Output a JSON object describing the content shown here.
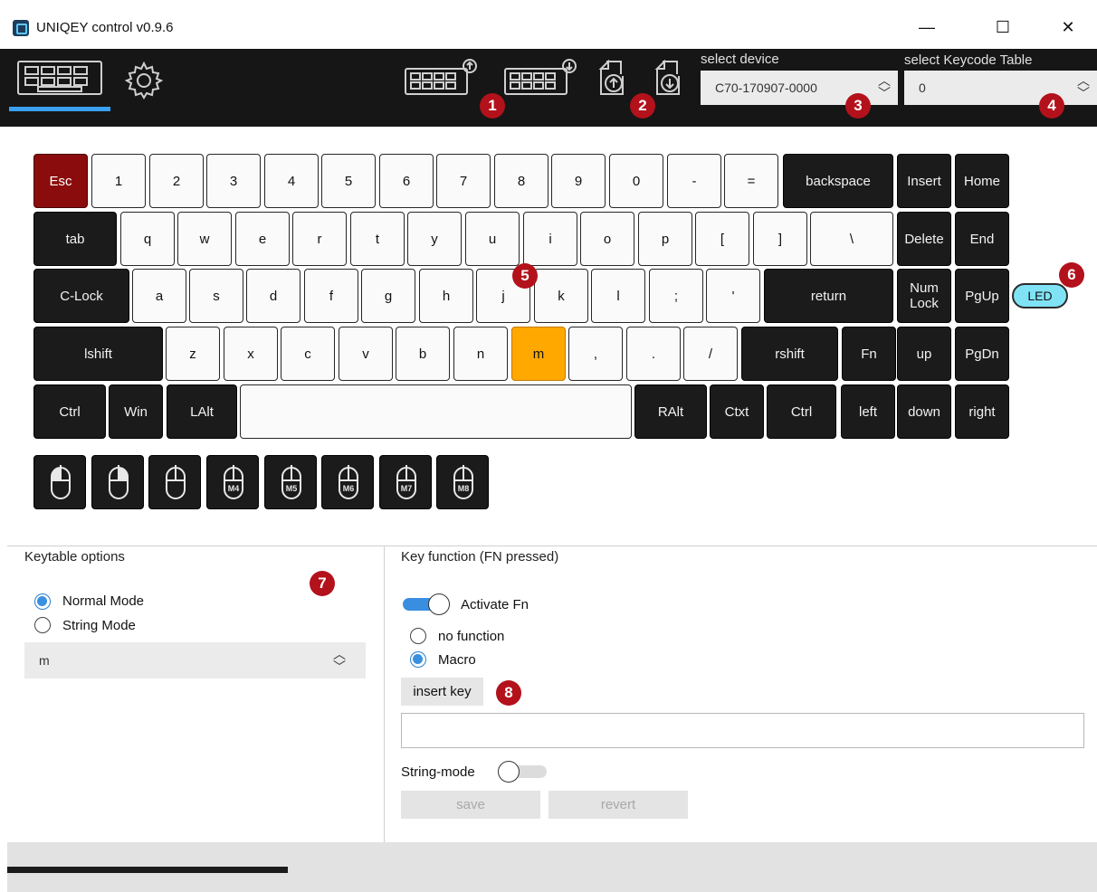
{
  "window": {
    "title": "UNIQEY control v0.9.6",
    "minimize": "—",
    "maximize": "☐",
    "close": "✕"
  },
  "toolbar": {
    "badges": [
      "1",
      "2",
      "3",
      "4"
    ],
    "device_label": "select device",
    "device_value": "C70-170907-0000",
    "keycode_label": "select Keycode Table",
    "keycode_value": "0"
  },
  "keyboard": {
    "badge": "5",
    "led_badge": "6",
    "led_label": "LED",
    "rows": [
      [
        "Esc",
        "1",
        "2",
        "3",
        "4",
        "5",
        "6",
        "7",
        "8",
        "9",
        "0",
        "-",
        "=",
        "backspace",
        "Insert",
        "Home"
      ],
      [
        "tab",
        "q",
        "w",
        "e",
        "r",
        "t",
        "y",
        "u",
        "i",
        "o",
        "p",
        "[",
        "]",
        "\\",
        "Delete",
        "End"
      ],
      [
        "C-Lock",
        "a",
        "s",
        "d",
        "f",
        "g",
        "h",
        "j",
        "k",
        "l",
        ";",
        "'",
        "return",
        "Num Lock",
        "PgUp"
      ],
      [
        "lshift",
        "z",
        "x",
        "c",
        "v",
        "b",
        "n",
        "m",
        ",",
        ".",
        "/",
        "rshift",
        "Fn",
        "up",
        "PgDn"
      ],
      [
        "Ctrl",
        "Win",
        "LAlt",
        "",
        "RAlt",
        "Ctxt",
        "Ctrl",
        "left",
        "down",
        "right"
      ]
    ],
    "mouse_keys": [
      "",
      "",
      "",
      "M4",
      "M5",
      "M6",
      "M7",
      "M8"
    ]
  },
  "keytable": {
    "title": "Keytable options",
    "badge": "7",
    "normal_mode": "Normal Mode",
    "string_mode": "String Mode",
    "key_value": "m"
  },
  "keyfunction": {
    "title": "Key function (FN pressed)",
    "activate_fn": "Activate Fn",
    "no_function": "no function",
    "macro": "Macro",
    "insert_key": "insert key",
    "badge": "8",
    "string_mode": "String-mode",
    "save": "save",
    "revert": "revert"
  },
  "colors": {
    "accent": "#3aa0f0",
    "badge": "#b3111b",
    "selected_key": "#ffa800",
    "esc_key": "#8b0c0c"
  }
}
